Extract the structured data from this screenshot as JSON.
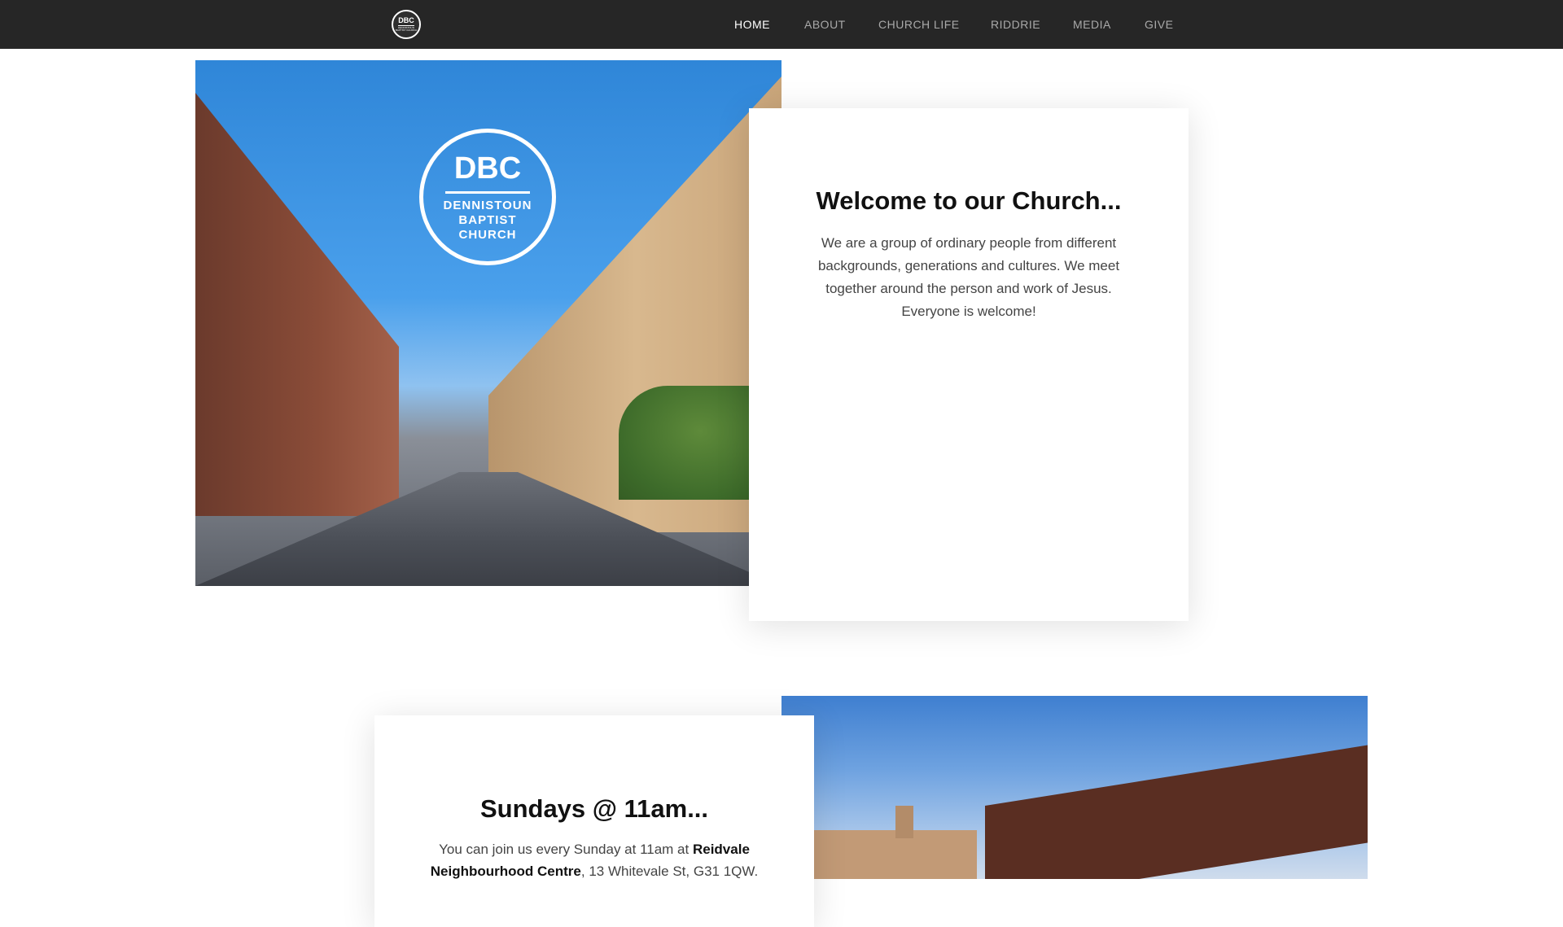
{
  "site": {
    "logo": {
      "abbr": "DBC",
      "name": "DENNISTOUN BAPTIST CHURCH"
    }
  },
  "nav": {
    "items": [
      {
        "label": "HOME",
        "active": true
      },
      {
        "label": "ABOUT",
        "active": false
      },
      {
        "label": "CHURCH LIFE",
        "active": false
      },
      {
        "label": "RIDDRIE",
        "active": false
      },
      {
        "label": "MEDIA",
        "active": false
      },
      {
        "label": "GIVE",
        "active": false
      }
    ]
  },
  "hero": {
    "badge": {
      "abbr": "DBC",
      "line1": "DENNISTOUN",
      "line2": "BAPTIST",
      "line3": "CHURCH"
    },
    "heading": "Welcome to our Church...",
    "body": "We are a group of ordinary people from different backgrounds, generations and cultures. We meet together around the person and work of Jesus. Everyone is welcome!"
  },
  "sundays": {
    "heading": "Sundays @ 11am...",
    "intro": "You can join us every Sunday at 11am at ",
    "venue": "Reidvale Neighbourhood Centre",
    "address": ", 13 Whitevale St, G31 1QW."
  },
  "colors": {
    "header_bg": "#262626",
    "nav_active": "#ffffff",
    "nav_inactive": "#a9a9a9"
  }
}
